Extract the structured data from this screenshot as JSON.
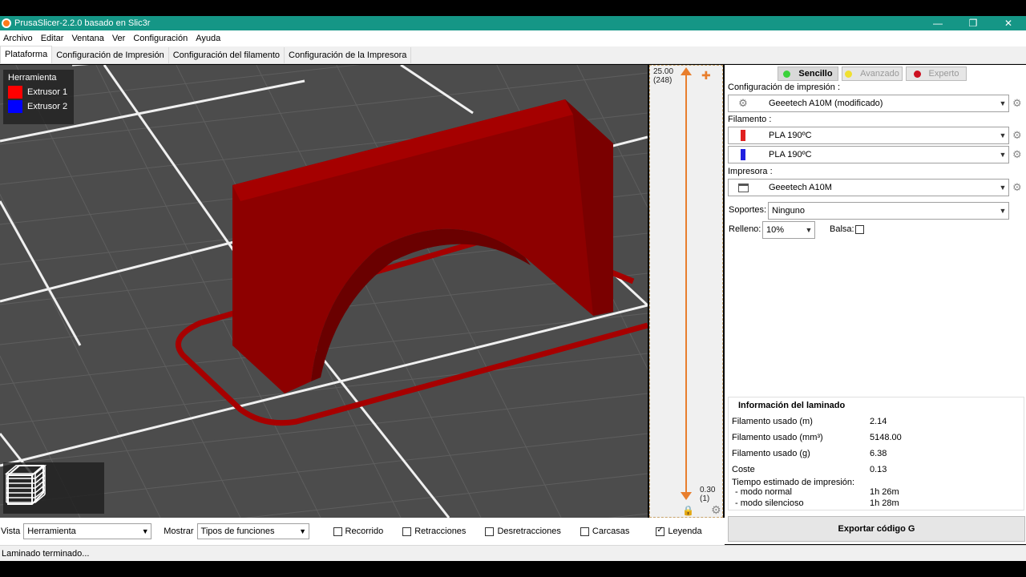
{
  "window": {
    "title": "PrusaSlicer-2.2.0 basado en Slic3r",
    "minimize": "—",
    "maximize": "❐",
    "close": "✕"
  },
  "menu": [
    "Archivo",
    "Editar",
    "Ventana",
    "Ver",
    "Configuración",
    "Ayuda"
  ],
  "tabs": [
    {
      "label": "Plataforma",
      "active": true
    },
    {
      "label": "Configuración de Impresión",
      "active": false
    },
    {
      "label": "Configuración del filamento",
      "active": false
    },
    {
      "label": "Configuración de la Impresora",
      "active": false
    }
  ],
  "legend": {
    "title": "Herramienta",
    "items": [
      {
        "label": "Extrusor 1",
        "color": "#ff0000"
      },
      {
        "label": "Extrusor 2",
        "color": "#0000ff"
      }
    ]
  },
  "layer_slider": {
    "top_height": "25.00",
    "top_layer": "(248)",
    "bottom_height": "0.30",
    "bottom_layer": "(1)",
    "accent": "#e87e2d"
  },
  "modes": [
    {
      "label": "Sencillo",
      "color": "#3ad23a",
      "active": true
    },
    {
      "label": "Avanzado",
      "color": "#f0e030",
      "active": false
    },
    {
      "label": "Experto",
      "color": "#cc1020",
      "active": false
    }
  ],
  "print_settings": {
    "label": "Configuración de impresión :",
    "value": "Geeetech A10M (modificado)"
  },
  "filament": {
    "label": "Filamento :",
    "items": [
      {
        "value": "PLA 190ºC",
        "color": "#e02020"
      },
      {
        "value": "PLA 190ºC",
        "color": "#2020e0"
      }
    ]
  },
  "printer": {
    "label": "Impresora :",
    "value": "Geeetech A10M"
  },
  "supports": {
    "label": "Soportes:",
    "value": "Ninguno"
  },
  "infill": {
    "label": "Relleno:",
    "value": "10%"
  },
  "brim": {
    "label": "Balsa:",
    "checked": false
  },
  "slice_info": {
    "title": "Información del laminado",
    "rows": [
      {
        "key": "Filamento usado (m)",
        "value": "2.14"
      },
      {
        "key": "Filamento usado (mm³)",
        "value": "5148.00"
      },
      {
        "key": "Filamento usado (g)",
        "value": "6.38"
      },
      {
        "key": "Coste",
        "value": "0.13"
      }
    ],
    "time_title": "Tiempo estimado de impresión:",
    "times": [
      {
        "key": "- modo normal",
        "value": "1h 26m"
      },
      {
        "key": "- modo silencioso",
        "value": "1h 28m"
      }
    ]
  },
  "export_button": "Exportar código G",
  "bottom": {
    "view_label": "Vista",
    "view_value": "Herramienta",
    "show_label": "Mostrar",
    "show_value": "Tipos de funciones",
    "checks": [
      {
        "label": "Recorrido",
        "checked": false
      },
      {
        "label": "Retracciones",
        "checked": false
      },
      {
        "label": "Desretracciones",
        "checked": false
      },
      {
        "label": "Carcasas",
        "checked": false
      },
      {
        "label": "Leyenda",
        "checked": true
      }
    ]
  },
  "status": "Laminado terminado..."
}
